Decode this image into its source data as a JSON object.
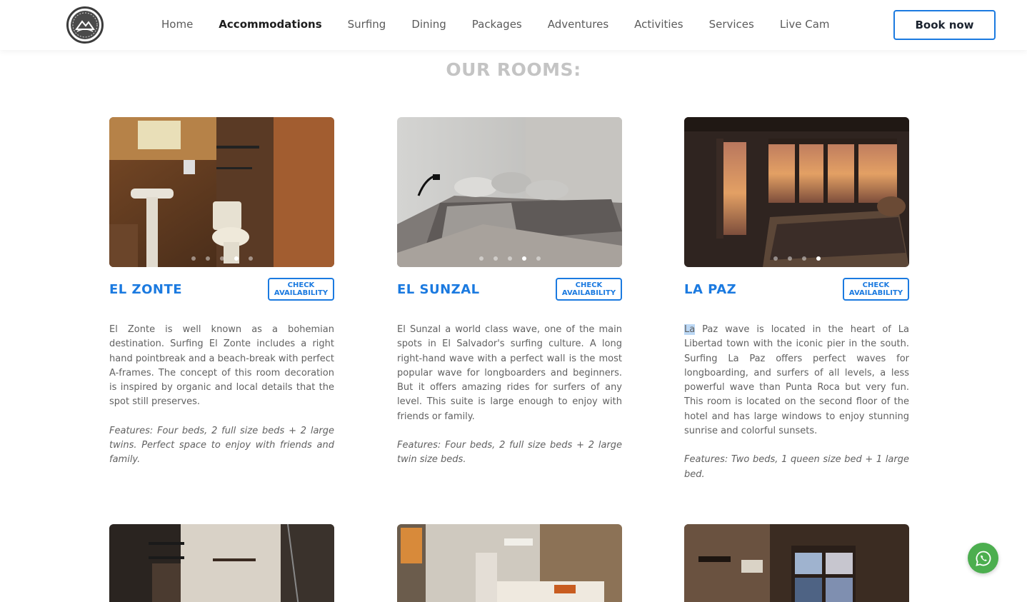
{
  "header": {
    "logo_alt": "Surf Hotel logo",
    "nav": [
      {
        "label": "Home",
        "active": false
      },
      {
        "label": "Accommodations",
        "active": true
      },
      {
        "label": "Surfing",
        "active": false
      },
      {
        "label": "Dining",
        "active": false
      },
      {
        "label": "Packages",
        "active": false
      },
      {
        "label": "Adventures",
        "active": false
      },
      {
        "label": "Activities",
        "active": false
      },
      {
        "label": "Services",
        "active": false
      },
      {
        "label": "Live Cam",
        "active": false
      }
    ],
    "book_label": "Book now"
  },
  "section_title": "OUR ROOMS:",
  "rooms": [
    {
      "name": "EL ZONTE",
      "check_label": "CHECK AVAILABILITY",
      "description": "El Zonte is well known as a bohemian destination. Surfing El Zonte includes a right hand pointbreak and a beach-break with perfect A-frames. The concept of this room decoration is inspired by organic and local details that the spot still preserves.",
      "features": "Features: Four beds, 2 full size beds + 2 large twins. Perfect space to enjoy with friends and family.",
      "dots_total": 5,
      "dots_active_index": 3
    },
    {
      "name": "EL SUNZAL",
      "check_label": "CHECK AVAILABILITY",
      "description": "El Sunzal a world class wave, one of the main spots in El Salvador's surfing culture. A long right-hand wave with a perfect wall is the most popular wave for longboarders and beginners. But it offers amazing rides for surfers of any level. This suite is large enough to enjoy with friends or family.",
      "features": "Features: Four beds, 2 full size beds + 2 large twin size beds.",
      "dots_total": 5,
      "dots_active_index": 3
    },
    {
      "name": "LA PAZ",
      "check_label": "CHECK AVAILABILITY",
      "description_highlight": "La",
      "description": " Paz wave is located in the heart of La Libertad town with the iconic pier in the south. Surfing La Paz offers perfect waves for longboarding, and surfers of all levels, a less powerful wave than Punta Roca but very fun. This room is located on the second floor of the hotel and has large windows to enjoy stunning sunrise and colorful sunsets.",
      "features": "Features: Two beds, 1 queen size bed + 1 large bed.",
      "dots_total": 4,
      "dots_active_index": 3
    }
  ],
  "colors": {
    "accent": "#1b7ae0",
    "title_gray": "#c4c4c4",
    "whatsapp": "#4cae4f"
  },
  "icons": {
    "logo": "surf-hotel-logo-icon",
    "chat": "whatsapp-icon"
  }
}
